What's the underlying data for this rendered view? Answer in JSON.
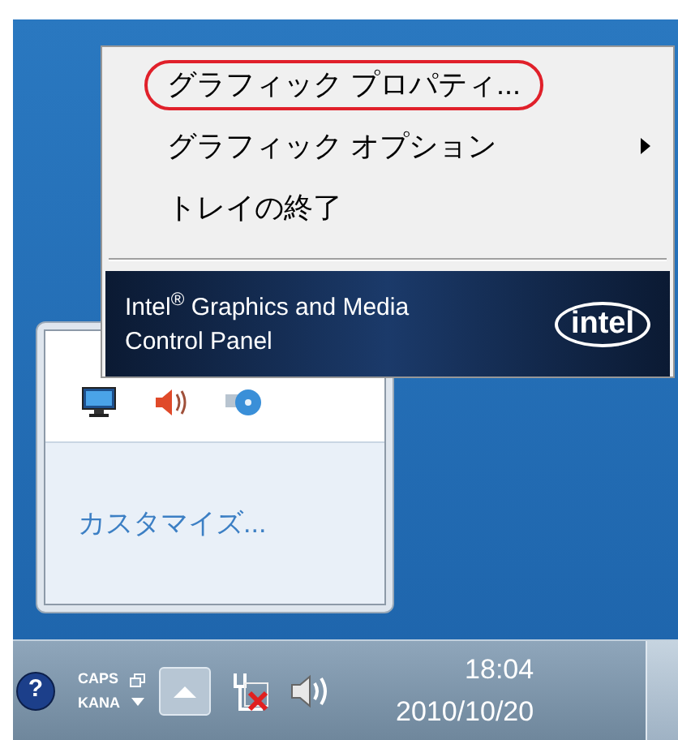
{
  "context_menu": {
    "items": [
      {
        "label": "グラフィック プロパティ...",
        "highlighted": true,
        "submenu": false
      },
      {
        "label": "グラフィック オプション",
        "highlighted": false,
        "submenu": true
      },
      {
        "label": "トレイの終了",
        "highlighted": false,
        "submenu": false
      }
    ],
    "banner": {
      "lines": [
        "Intel$^{®}$ Graphics and Media",
        "Control Panel"
      ],
      "logo": "intel"
    }
  },
  "tray_popup": {
    "link": "カスタマイズ..."
  },
  "taskbar": {
    "help": "?",
    "indicators": [
      "CAPS",
      "KANA"
    ],
    "time": "18:04",
    "date": "2010/10/20"
  }
}
